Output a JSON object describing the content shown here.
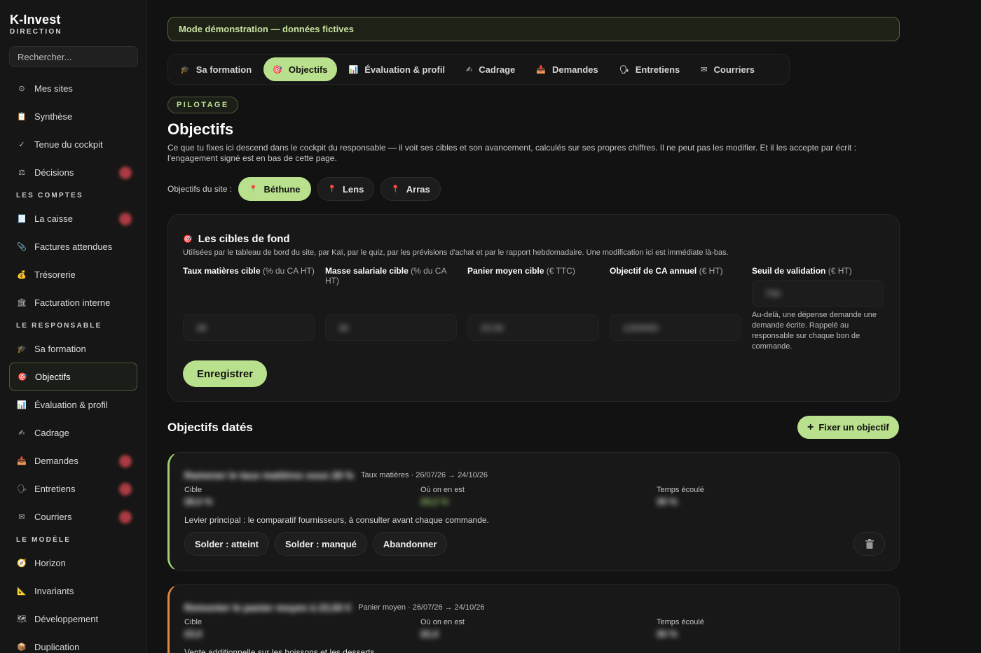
{
  "brand": {
    "name": "K-Invest",
    "subtitle": "DIRECTION"
  },
  "search": {
    "placeholder": "Rechercher..."
  },
  "sidebar": {
    "top_items": [
      {
        "icon": "⊙",
        "label": "Mes sites"
      },
      {
        "icon": "📋",
        "label": "Synthèse"
      },
      {
        "icon": "✓",
        "label": "Tenue du cockpit"
      },
      {
        "icon": "⚖",
        "label": "Décisions"
      }
    ],
    "section_comptes": "LES COMPTES",
    "comptes_items": [
      {
        "icon": "🧾",
        "label": "La caisse"
      },
      {
        "icon": "📎",
        "label": "Factures attendues"
      },
      {
        "icon": "💰",
        "label": "Trésorerie"
      },
      {
        "icon": "🏛",
        "label": "Facturation interne"
      }
    ],
    "section_responsable": "LE RESPONSABLE",
    "responsable_items": [
      {
        "icon": "🎓",
        "label": "Sa formation"
      },
      {
        "icon": "🎯",
        "label": "Objectifs"
      },
      {
        "icon": "📊",
        "label": "Évaluation & profil"
      },
      {
        "icon": "✍",
        "label": "Cadrage"
      },
      {
        "icon": "📥",
        "label": "Demandes"
      },
      {
        "icon": "🗣",
        "label": "Entretiens"
      },
      {
        "icon": "✉",
        "label": "Courriers"
      }
    ],
    "section_modele": "LE MODÈLE",
    "modele_items": [
      {
        "icon": "🧭",
        "label": "Horizon"
      },
      {
        "icon": "📐",
        "label": "Invariants"
      },
      {
        "icon": "🗺",
        "label": "Développement"
      },
      {
        "icon": "📦",
        "label": "Duplication"
      }
    ]
  },
  "banner": "Mode démonstration — données fictives",
  "tabs": [
    {
      "icon": "🎓",
      "label": "Sa formation"
    },
    {
      "icon": "🎯",
      "label": "Objectifs"
    },
    {
      "icon": "📊",
      "label": "Évaluation & profil"
    },
    {
      "icon": "✍",
      "label": "Cadrage"
    },
    {
      "icon": "📥",
      "label": "Demandes"
    },
    {
      "icon": "🗣",
      "label": "Entretiens"
    },
    {
      "icon": "✉",
      "label": "Courriers"
    }
  ],
  "page": {
    "pill": "PILOTAGE",
    "title": "Objectifs",
    "description": "Ce que tu fixes ici descend dans le cockpit du responsable — il voit ses cibles et son avancement, calculés sur ses propres chiffres. Il ne peut pas les modifier. Et il les accepte par écrit : l'engagement signé est en bas de cette page."
  },
  "sites": {
    "label": "Objectifs du site :",
    "items": [
      "Béthune",
      "Lens",
      "Arras"
    ]
  },
  "targets": {
    "title": "Les cibles de fond",
    "subtitle": "Utilisées par le tableau de bord du site, par Kaï, par le quiz, par les prévisions d'achat et par le rapport hebdomadaire. Une modification ici est immédiate là-bas.",
    "fields": [
      {
        "label": "Taux matières cible",
        "unit": "(% du CA HT)",
        "value": "28"
      },
      {
        "label": "Masse salariale cible",
        "unit": "(% du CA HT)",
        "value": "30"
      },
      {
        "label": "Panier moyen cible",
        "unit": "(€ TTC)",
        "value": "23,50"
      },
      {
        "label": "Objectif de CA annuel",
        "unit": "(€ HT)",
        "value": "1200000"
      },
      {
        "label": "Seuil de validation",
        "unit": "(€ HT)",
        "value": "700",
        "hint": "Au-delà, une dépense demande une demande écrite. Rappelé au responsable sur chaque bon de commande."
      }
    ],
    "save_label": "Enregistrer"
  },
  "dated": {
    "title": "Objectifs datés",
    "add_label": "Fixer un objectif",
    "items": [
      {
        "name": "Ramener le taux matières sous 28 %",
        "meta": "Taux matières · 26/07/26 → 24/10/26",
        "target_label": "Cible",
        "target_value": "28,0 %",
        "current_label": "Où on en est",
        "current_value": "29,2 %",
        "elapsed_label": "Temps écoulé",
        "elapsed_value": "30 %",
        "lever": "Levier principal : le comparatif fournisseurs, à consulter avant chaque commande.",
        "actions": [
          "Solder : atteint",
          "Solder : manqué",
          "Abandonner"
        ]
      },
      {
        "name": "Remonter le panier moyen à 23,50 €",
        "meta": "Panier moyen · 26/07/26 → 24/10/26",
        "target_label": "Cible",
        "target_value": "23,5",
        "current_label": "Où on en est",
        "current_value": "22,4",
        "elapsed_label": "Temps écoulé",
        "elapsed_value": "30 %",
        "lever": "Vente additionnelle sur les boissons et les desserts."
      }
    ]
  },
  "colors": {
    "accent": "#b9e08c",
    "background": "#121212",
    "orange": "#e18a3b"
  }
}
